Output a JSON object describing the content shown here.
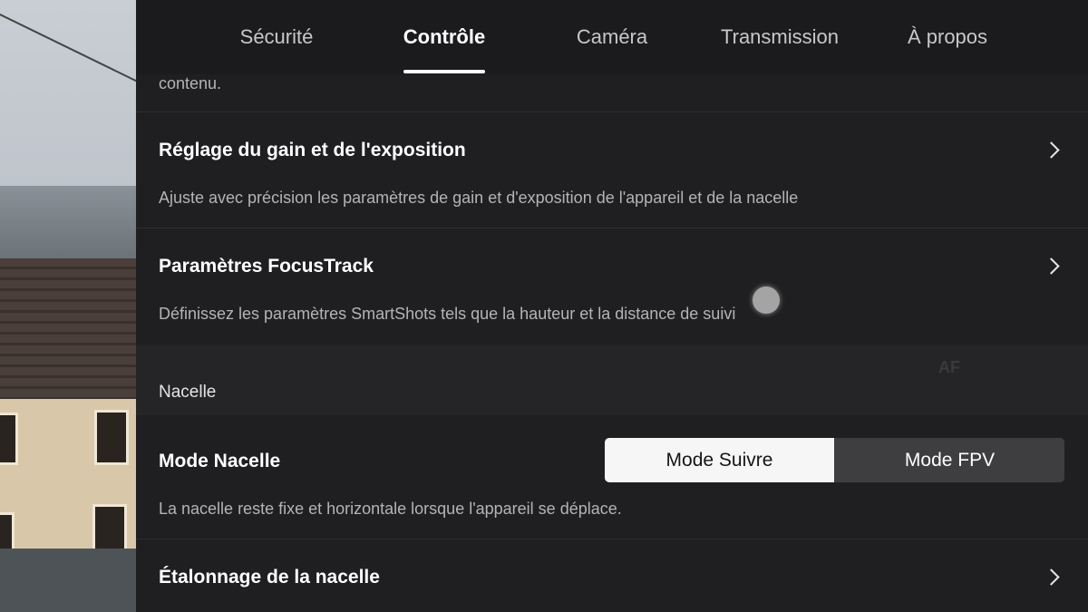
{
  "tabs": [
    {
      "label": "Sécurité",
      "active": false
    },
    {
      "label": "Contrôle",
      "active": true
    },
    {
      "label": "Caméra",
      "active": false
    },
    {
      "label": "Transmission",
      "active": false
    },
    {
      "label": "À propos",
      "active": false
    }
  ],
  "partial_text": "contenu.",
  "settings": {
    "gain_exposure": {
      "title": "Réglage du gain et de l'exposition",
      "description": "Ajuste avec précision les paramètres de gain et d'exposition de l'appareil et de la nacelle"
    },
    "focustrack": {
      "title": "Paramètres FocusTrack",
      "description": "Définissez les paramètres SmartShots tels que la hauteur et la distance de suivi"
    }
  },
  "section_gimbal": {
    "label": "Nacelle",
    "mode": {
      "title": "Mode Nacelle",
      "options": [
        "Mode Suivre",
        "Mode FPV"
      ],
      "selected": "Mode Suivre",
      "description": "La nacelle reste fixe et horizontale lorsque l'appareil se déplace."
    },
    "calibration": {
      "title": "Étalonnage de la nacelle"
    }
  },
  "overlay_hint": "AF",
  "colors": {
    "background": "#1f1f21",
    "selected_segment": "#f6f6f6",
    "unselected_segment": "#3e3e41"
  }
}
